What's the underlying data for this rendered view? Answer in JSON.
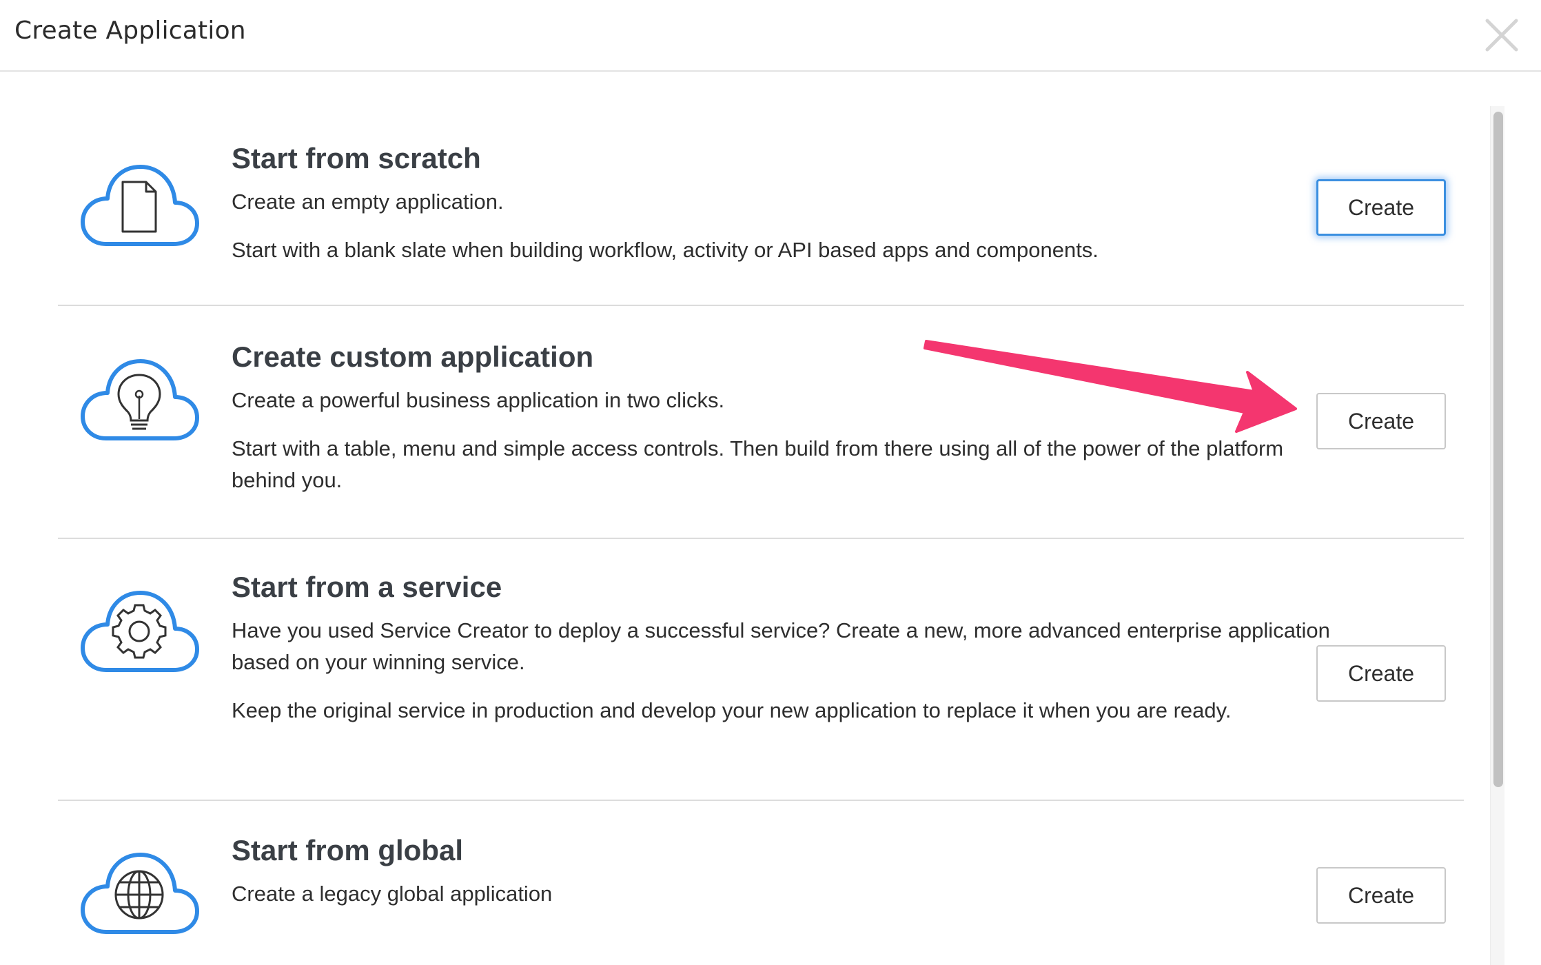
{
  "dialog": {
    "title": "Create Application",
    "close_icon": "close-icon"
  },
  "options": [
    {
      "icon": "cloud-document-icon",
      "title": "Start from scratch",
      "description": "Create an empty application.",
      "detail": "Start with a blank slate when building workflow, activity or API based apps and components.",
      "button_label": "Create"
    },
    {
      "icon": "cloud-lightbulb-icon",
      "title": "Create custom application",
      "description": "Create a powerful business application in two clicks.",
      "detail": "Start with a table, menu and simple access controls. Then build from there using all of the power of the platform behind you.",
      "button_label": "Create"
    },
    {
      "icon": "cloud-gear-icon",
      "title": "Start from a service",
      "description": "Have you used Service Creator to deploy a successful service? Create a new, more advanced enterprise application based on your winning service.",
      "detail": "Keep the original service in production and develop your new application to replace it when you are ready.",
      "button_label": "Create"
    },
    {
      "icon": "cloud-globe-icon",
      "title": "Start from global",
      "description": "Create a legacy global application",
      "detail": "",
      "button_label": "Create"
    }
  ],
  "colors": {
    "icon_blue": "#2f8ae6",
    "annotation_pink": "#f4366f",
    "focus_blue": "#3b8fe0"
  }
}
